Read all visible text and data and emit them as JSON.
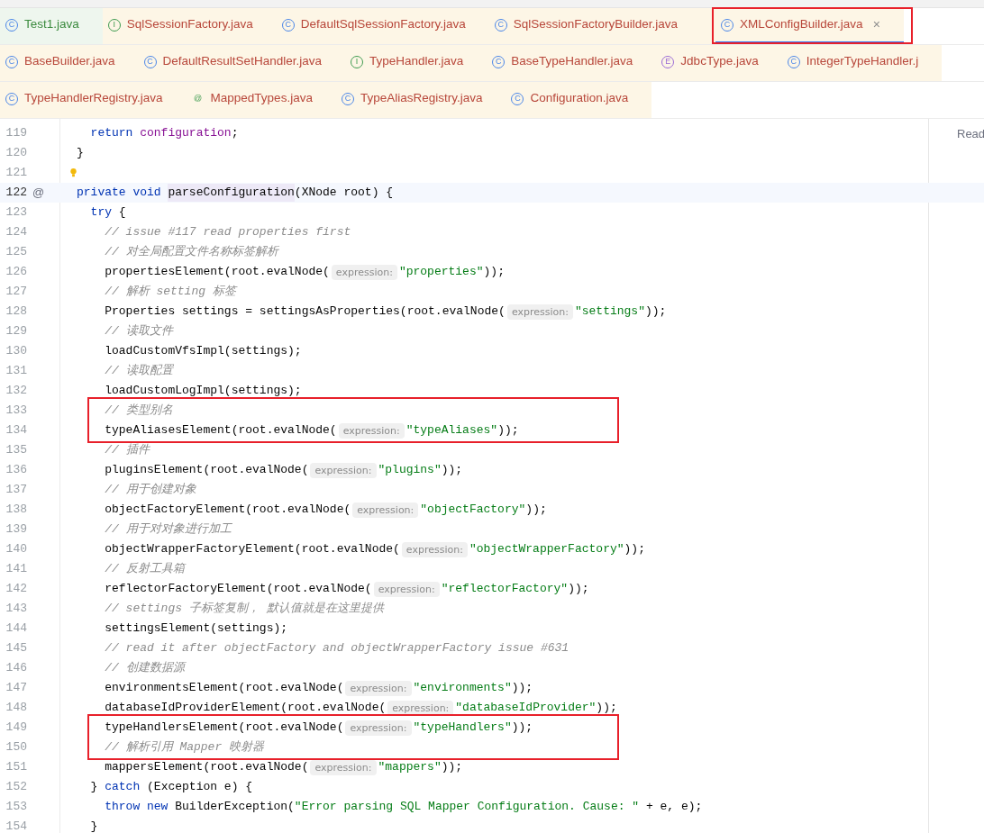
{
  "tab_rows": [
    {
      "tabs": [
        {
          "label": "Test1.java",
          "kind": "class",
          "icon": "C",
          "color": "#3b8a3e",
          "selected": false,
          "boxed": false,
          "closable": false
        },
        {
          "label": "SqlSessionFactory.java",
          "kind": "interface",
          "icon": "I",
          "color": "#b8473a",
          "selected": false,
          "boxed": false,
          "closable": false
        },
        {
          "label": "DefaultSqlSessionFactory.java",
          "kind": "class",
          "icon": "C",
          "color": "#b8473a",
          "selected": false,
          "boxed": false,
          "closable": false
        },
        {
          "label": "SqlSessionFactoryBuilder.java",
          "kind": "class",
          "icon": "C",
          "color": "#b8473a",
          "selected": false,
          "boxed": false,
          "closable": false
        },
        {
          "label": "XMLConfigBuilder.java",
          "kind": "class",
          "icon": "C",
          "color": "#b8473a",
          "selected": true,
          "boxed": true,
          "closable": true,
          "close": "×"
        }
      ]
    },
    {
      "tabs": [
        {
          "label": "BaseBuilder.java",
          "kind": "class",
          "icon": "C",
          "color": "#b8473a",
          "selected": false,
          "boxed": false,
          "closable": false
        },
        {
          "label": "DefaultResultSetHandler.java",
          "kind": "class",
          "icon": "C",
          "color": "#b8473a",
          "selected": false,
          "boxed": false,
          "closable": false
        },
        {
          "label": "TypeHandler.java",
          "kind": "interface",
          "icon": "I",
          "color": "#b8473a",
          "selected": false,
          "boxed": false,
          "closable": false
        },
        {
          "label": "BaseTypeHandler.java",
          "kind": "class",
          "icon": "C",
          "color": "#b8473a",
          "selected": false,
          "boxed": false,
          "closable": false
        },
        {
          "label": "JdbcType.java",
          "kind": "enum",
          "icon": "E",
          "color": "#b8473a",
          "selected": false,
          "boxed": false,
          "closable": false
        },
        {
          "label": "IntegerTypeHandler.j",
          "kind": "class",
          "icon": "C",
          "color": "#b8473a",
          "selected": false,
          "boxed": false,
          "closable": false
        }
      ]
    },
    {
      "tabs": [
        {
          "label": "TypeHandlerRegistry.java",
          "kind": "class",
          "icon": "C",
          "color": "#b8473a",
          "selected": false,
          "boxed": false,
          "closable": false
        },
        {
          "label": "MappedTypes.java",
          "kind": "annotation",
          "icon": "@",
          "color": "#b8473a",
          "selected": false,
          "boxed": false,
          "closable": false
        },
        {
          "label": "TypeAliasRegistry.java",
          "kind": "class",
          "icon": "C",
          "color": "#b8473a",
          "selected": false,
          "boxed": false,
          "closable": false
        },
        {
          "label": "Configuration.java",
          "kind": "class",
          "icon": "C",
          "color": "#b8473a",
          "selected": false,
          "boxed": false,
          "closable": false
        }
      ]
    }
  ],
  "reader_mode": "Read",
  "blocks": [
    {
      "boxed": false,
      "lines": [
        {
          "number": "119",
          "current": false,
          "bulb": false,
          "tokens": [
            {
              "kind": "keyword",
              "text": "  return "
            },
            {
              "kind": "field",
              "text": "configuration"
            },
            {
              "kind": "plain",
              "text": ";"
            }
          ]
        },
        {
          "number": "120",
          "current": false,
          "bulb": false,
          "tokens": [
            {
              "kind": "plain",
              "text": "}"
            }
          ]
        },
        {
          "number": "121",
          "current": false,
          "bulb": true
        },
        {
          "number": "122",
          "current": true,
          "bulb": false,
          "marker": "@",
          "tokens": [
            {
              "kind": "keyword",
              "text": "private void "
            },
            {
              "kind": "decl",
              "text": "parseConfiguration"
            },
            {
              "kind": "plain",
              "text": "(XNode root) {"
            }
          ]
        },
        {
          "number": "123",
          "current": false,
          "bulb": false,
          "tokens": [
            {
              "kind": "keyword",
              "text": "  try"
            },
            {
              "kind": "plain",
              "text": " {"
            }
          ]
        },
        {
          "number": "124",
          "current": false,
          "bulb": false,
          "tokens": [
            {
              "kind": "comment",
              "text": "    // issue #117 read properties first"
            }
          ]
        },
        {
          "number": "125",
          "current": false,
          "bulb": false,
          "tokens": [
            {
              "kind": "comment",
              "text": "    // 对全局配置文件名称标签解析"
            }
          ]
        },
        {
          "number": "126",
          "current": false,
          "bulb": false,
          "tokens": [
            {
              "kind": "plain",
              "text": "    propertiesElement(root.evalNode("
            },
            {
              "kind": "hint",
              "text": "expression:"
            },
            {
              "kind": "string",
              "text": "\"properties\""
            },
            {
              "kind": "plain",
              "text": "));"
            }
          ]
        },
        {
          "number": "127",
          "current": false,
          "bulb": false,
          "tokens": [
            {
              "kind": "comment",
              "text": "    // 解析 setting 标签"
            }
          ]
        },
        {
          "number": "128",
          "current": false,
          "bulb": false,
          "tokens": [
            {
              "kind": "plain",
              "text": "    Properties settings = settingsAsProperties(root.evalNode("
            },
            {
              "kind": "hint",
              "text": "expression:"
            },
            {
              "kind": "string",
              "text": "\"settings\""
            },
            {
              "kind": "plain",
              "text": "));"
            }
          ]
        },
        {
          "number": "129",
          "current": false,
          "bulb": false,
          "tokens": [
            {
              "kind": "comment",
              "text": "    // 读取文件"
            }
          ]
        },
        {
          "number": "130",
          "current": false,
          "bulb": false,
          "tokens": [
            {
              "kind": "plain",
              "text": "    loadCustomVfsImpl(settings);"
            }
          ]
        },
        {
          "number": "131",
          "current": false,
          "bulb": false,
          "tokens": [
            {
              "kind": "comment",
              "text": "    // 读取配置"
            }
          ]
        },
        {
          "number": "132",
          "current": false,
          "bulb": false,
          "tokens": [
            {
              "kind": "plain",
              "text": "    loadCustomLogImpl(settings);"
            }
          ]
        }
      ]
    },
    {
      "boxed": true,
      "lines": [
        {
          "number": "133",
          "current": false,
          "bulb": false,
          "tokens": [
            {
              "kind": "comment",
              "text": "    // 类型别名"
            }
          ]
        },
        {
          "number": "134",
          "current": false,
          "bulb": false,
          "tokens": [
            {
              "kind": "plain",
              "text": "    typeAliasesElement(root.evalNode("
            },
            {
              "kind": "hint",
              "text": "expression:"
            },
            {
              "kind": "string",
              "text": "\"typeAliases\""
            },
            {
              "kind": "plain",
              "text": "));"
            }
          ]
        }
      ]
    },
    {
      "boxed": false,
      "lines": [
        {
          "number": "135",
          "current": false,
          "bulb": false,
          "tokens": [
            {
              "kind": "comment",
              "text": "    // 插件"
            }
          ]
        },
        {
          "number": "136",
          "current": false,
          "bulb": false,
          "tokens": [
            {
              "kind": "plain",
              "text": "    pluginsElement(root.evalNode("
            },
            {
              "kind": "hint",
              "text": "expression:"
            },
            {
              "kind": "string",
              "text": "\"plugins\""
            },
            {
              "kind": "plain",
              "text": "));"
            }
          ]
        },
        {
          "number": "137",
          "current": false,
          "bulb": false,
          "tokens": [
            {
              "kind": "comment",
              "text": "    // 用于创建对象"
            }
          ]
        },
        {
          "number": "138",
          "current": false,
          "bulb": false,
          "tokens": [
            {
              "kind": "plain",
              "text": "    objectFactoryElement(root.evalNode("
            },
            {
              "kind": "hint",
              "text": "expression:"
            },
            {
              "kind": "string",
              "text": "\"objectFactory\""
            },
            {
              "kind": "plain",
              "text": "));"
            }
          ]
        },
        {
          "number": "139",
          "current": false,
          "bulb": false,
          "tokens": [
            {
              "kind": "comment",
              "text": "    // 用于对对象进行加工"
            }
          ]
        },
        {
          "number": "140",
          "current": false,
          "bulb": false,
          "tokens": [
            {
              "kind": "plain",
              "text": "    objectWrapperFactoryElement(root.evalNode("
            },
            {
              "kind": "hint",
              "text": "expression:"
            },
            {
              "kind": "string",
              "text": "\"objectWrapperFactory\""
            },
            {
              "kind": "plain",
              "text": "));"
            }
          ]
        },
        {
          "number": "141",
          "current": false,
          "bulb": false,
          "tokens": [
            {
              "kind": "comment",
              "text": "    // 反射工具箱"
            }
          ]
        },
        {
          "number": "142",
          "current": false,
          "bulb": false,
          "tokens": [
            {
              "kind": "plain",
              "text": "    reflectorFactoryElement(root.evalNode("
            },
            {
              "kind": "hint",
              "text": "expression:"
            },
            {
              "kind": "string",
              "text": "\"reflectorFactory\""
            },
            {
              "kind": "plain",
              "text": "));"
            }
          ]
        },
        {
          "number": "143",
          "current": false,
          "bulb": false,
          "tokens": [
            {
              "kind": "comment",
              "text": "    // settings 子标签复制， 默认值就是在这里提供"
            }
          ]
        },
        {
          "number": "144",
          "current": false,
          "bulb": false,
          "tokens": [
            {
              "kind": "plain",
              "text": "    settingsElement(settings);"
            }
          ]
        },
        {
          "number": "145",
          "current": false,
          "bulb": false,
          "tokens": [
            {
              "kind": "comment",
              "text": "    // read it after objectFactory and objectWrapperFactory issue #631"
            }
          ]
        },
        {
          "number": "146",
          "current": false,
          "bulb": false,
          "tokens": [
            {
              "kind": "comment",
              "text": "    // 创建数据源"
            }
          ]
        },
        {
          "number": "147",
          "current": false,
          "bulb": false,
          "tokens": [
            {
              "kind": "plain",
              "text": "    environmentsElement(root.evalNode("
            },
            {
              "kind": "hint",
              "text": "expression:"
            },
            {
              "kind": "string",
              "text": "\"environments\""
            },
            {
              "kind": "plain",
              "text": "));"
            }
          ]
        },
        {
          "number": "148",
          "current": false,
          "bulb": false,
          "tokens": [
            {
              "kind": "plain",
              "text": "    databaseIdProviderElement(root.evalNode("
            },
            {
              "kind": "hint",
              "text": "expression:"
            },
            {
              "kind": "string",
              "text": "\"databaseIdProvider\""
            },
            {
              "kind": "plain",
              "text": "));"
            }
          ]
        }
      ]
    },
    {
      "boxed": true,
      "lines": [
        {
          "number": "149",
          "current": false,
          "bulb": false,
          "tokens": [
            {
              "kind": "plain",
              "text": "    typeHandlersElement(root.evalNode("
            },
            {
              "kind": "hint",
              "text": "expression:"
            },
            {
              "kind": "string",
              "text": "\"typeHandlers\""
            },
            {
              "kind": "plain",
              "text": "));"
            }
          ]
        },
        {
          "number": "150",
          "current": false,
          "bulb": false,
          "tokens": [
            {
              "kind": "comment",
              "text": "    // 解析引用 Mapper 映射器"
            }
          ]
        }
      ]
    },
    {
      "boxed": false,
      "lines": [
        {
          "number": "151",
          "current": false,
          "bulb": false,
          "tokens": [
            {
              "kind": "plain",
              "text": "    mappersElement(root.evalNode("
            },
            {
              "kind": "hint",
              "text": "expression:"
            },
            {
              "kind": "string",
              "text": "\"mappers\""
            },
            {
              "kind": "plain",
              "text": "));"
            }
          ]
        },
        {
          "number": "152",
          "current": false,
          "bulb": false,
          "tokens": [
            {
              "kind": "plain",
              "text": "  } "
            },
            {
              "kind": "keyword",
              "text": "catch"
            },
            {
              "kind": "plain",
              "text": " (Exception e) {"
            }
          ]
        },
        {
          "number": "153",
          "current": false,
          "bulb": false,
          "tokens": [
            {
              "kind": "keyword",
              "text": "    throw new"
            },
            {
              "kind": "plain",
              "text": " BuilderException("
            },
            {
              "kind": "string",
              "text": "\"Error parsing SQL Mapper Configuration. Cause: \""
            },
            {
              "kind": "plain",
              "text": " + e, e);"
            }
          ]
        },
        {
          "number": "154",
          "current": false,
          "bulb": false,
          "tokens": [
            {
              "kind": "plain",
              "text": "  }"
            }
          ]
        }
      ]
    }
  ]
}
